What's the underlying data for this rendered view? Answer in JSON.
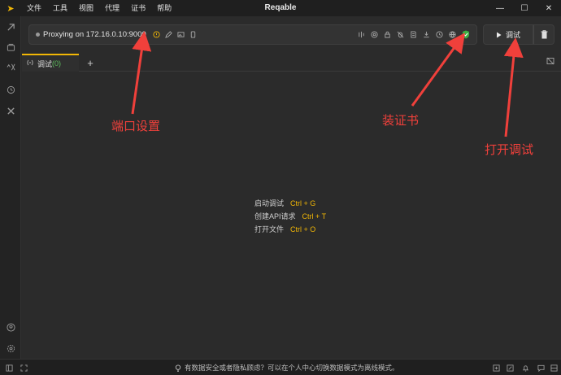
{
  "app": {
    "title": "Reqable"
  },
  "menu": [
    "文件",
    "工具",
    "视图",
    "代理",
    "证书",
    "帮助"
  ],
  "window_controls": {
    "minimize": "—",
    "maximize": "☐",
    "close": "✕"
  },
  "proxy": {
    "status_text": "Proxying on 172.16.0.10:9000"
  },
  "debug_button": {
    "label": "调试"
  },
  "tab": {
    "label": "调试",
    "count": "(0)"
  },
  "shortcuts": [
    {
      "label": "启动调试",
      "key": "Ctrl + G"
    },
    {
      "label": "创建API请求",
      "key": "Ctrl + T"
    },
    {
      "label": "打开文件",
      "key": "Ctrl + O"
    }
  ],
  "annotations": {
    "port_settings": "端口设置",
    "install_cert": "装证书",
    "open_debug": "打开调试"
  },
  "statusbar": {
    "message": "有数据安全或者隐私顾虑？可以在个人中心切换数据模式为离线模式。"
  },
  "colors": {
    "accent": "#f2b705",
    "annotation": "#f0403b",
    "cert_ok": "#3cb043"
  }
}
